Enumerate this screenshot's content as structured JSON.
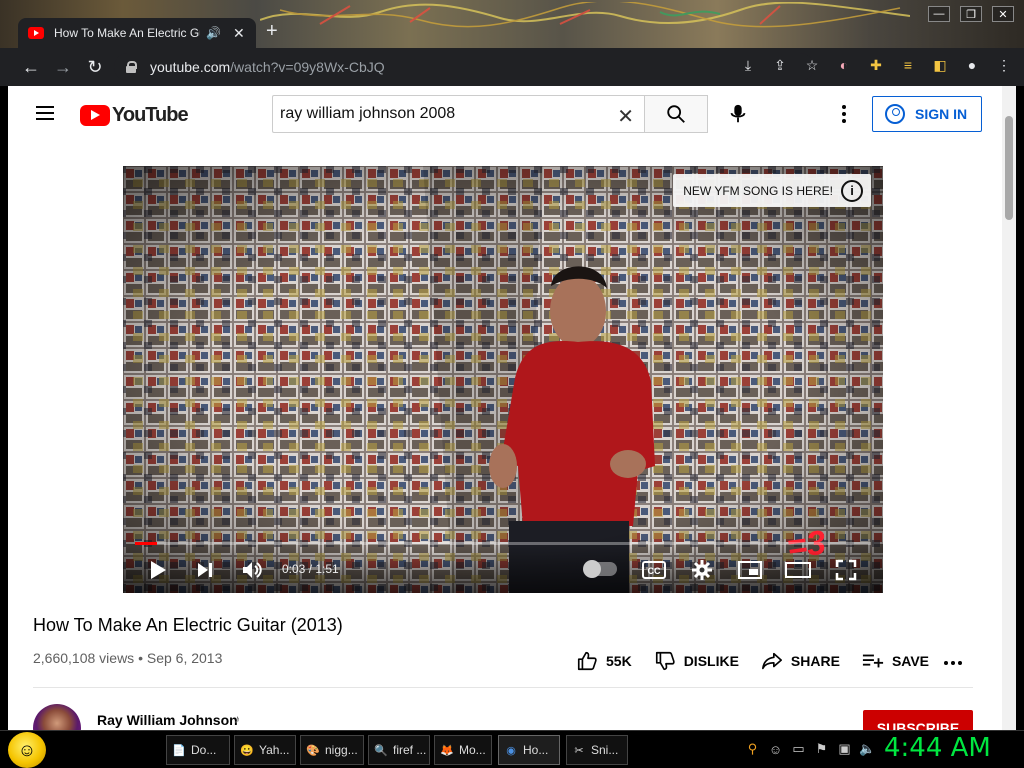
{
  "browser": {
    "tab_title": "How To Make An Electric Gu",
    "url_host": "youtube.com",
    "url_path": "/watch?v=09y8Wx-CbJQ",
    "window_controls": [
      "minimize-icon",
      "maximize-icon",
      "close-icon"
    ]
  },
  "youtube": {
    "logo_text": "YouTube",
    "search_query": "ray william johnson 2008",
    "sign_in_label": "SIGN IN",
    "colors": {
      "brand_red": "#ff0000",
      "link_blue": "#065fd4",
      "subscribe_red": "#cc0000"
    }
  },
  "player": {
    "ad_card_text": "NEW YFM SONG IS HERE!",
    "ad_info_glyph": "i",
    "time_display": "0:03 / 1:51",
    "watermark_text": "=3",
    "progress_fraction": 0.03
  },
  "video": {
    "title": "How To Make An Electric Guitar (2013)",
    "meta": "2,660,108 views • Sep 6, 2013",
    "actions": {
      "likes": "55K",
      "dislike": "DISLIKE",
      "share": "SHARE",
      "save": "SAVE"
    }
  },
  "channel": {
    "name": "Ray William Johnson",
    "note_glyph": "♪",
    "subscribe_label": "SUBSCRIBE"
  },
  "taskbar": {
    "start_glyph": "☺",
    "tasks": [
      {
        "label": "Do...",
        "icon": "📄"
      },
      {
        "label": "Yah...",
        "icon": "😀"
      },
      {
        "label": "nigg...",
        "icon": "🎨"
      },
      {
        "label": "firef ...",
        "icon": "🔍"
      },
      {
        "label": "Mo...",
        "icon": "🦊"
      },
      {
        "label": "Ho...",
        "icon": "◉"
      },
      {
        "label": "Sni...",
        "icon": "✂"
      }
    ],
    "clock": "4:44 AM"
  }
}
